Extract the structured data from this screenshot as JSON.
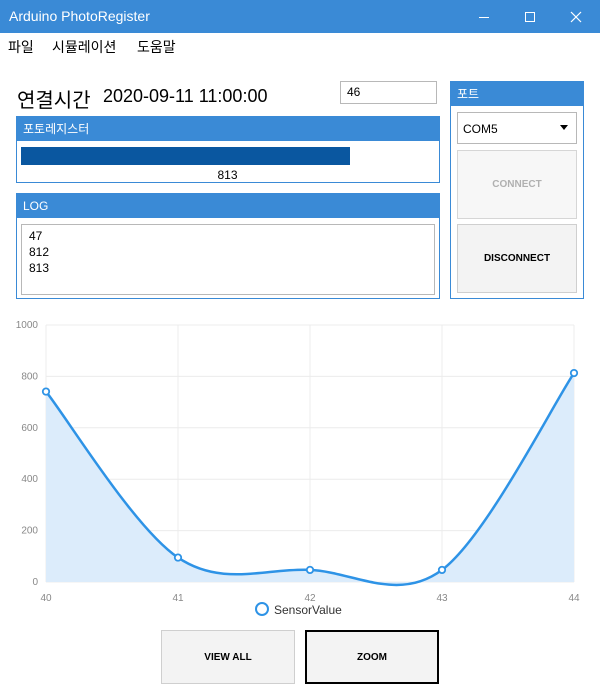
{
  "window": {
    "title": "Arduino PhotoRegister"
  },
  "menu": [
    {
      "label": "파일"
    },
    {
      "label": "시뮬레이션"
    },
    {
      "label": "도움말"
    }
  ],
  "connection": {
    "label": "연결시간",
    "value": "2020-09-11 11:00:00",
    "input_value": "46"
  },
  "photo_panel": {
    "title": "포토레지스터",
    "bar_value": "813",
    "bar_fraction": 0.813
  },
  "log_panel": {
    "title": "LOG",
    "lines": [
      "47",
      "812",
      "813"
    ]
  },
  "port_panel": {
    "title": "포트",
    "selected": "COM5",
    "connect_label": "CONNECT",
    "disconnect_label": "DISCONNECT"
  },
  "buttons": {
    "view_all": "VIEW ALL",
    "zoom": "ZOOM"
  },
  "colors": {
    "accent": "#3a8ad6",
    "bar": "#0a57a0",
    "line": "#2e93e6",
    "area": "#dcecfb"
  },
  "chart_data": {
    "type": "area",
    "x": [
      40,
      41,
      42,
      43,
      44
    ],
    "series": [
      {
        "name": "SensorValue",
        "values": [
          741,
          95,
          47,
          47,
          813
        ]
      }
    ],
    "ylim": [
      0,
      1000
    ],
    "yticks": [
      "0",
      "200",
      "400",
      "600",
      "800",
      "1000"
    ],
    "xticks": [
      "40",
      "41",
      "42",
      "43",
      "44"
    ],
    "grid": true,
    "legend": "bottom"
  }
}
